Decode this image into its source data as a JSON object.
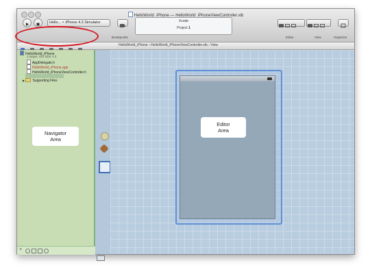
{
  "window": {
    "title": "HelloWorld_iPhone — HelloWorld_iPhoneViewController.xib"
  },
  "toolbar": {
    "scheme_label": "Hello... ‣ iPhone 4.3 Simulator",
    "breakpoints_label": "Breakpoints",
    "activity_title": "Xcode",
    "activity_project_label": "Project",
    "activity_count": "1",
    "editor_label": "Editor",
    "view_label": "View",
    "organizer_label": "Organizer"
  },
  "jumpbar": {
    "crumbs": [
      "HelloWorld_iPhone",
      "HelloWorld_iPhoneViewController.xib",
      "View"
    ]
  },
  "navigator": {
    "project_name": "HelloWorld_iPhone",
    "project_subtitle": "1 target, iOS SDK 4.3",
    "files": [
      {
        "name": "AppDelegate.h",
        "kind": "file",
        "color": "#222222"
      },
      {
        "name": "HelloWorld_iPhone.app",
        "kind": "file",
        "color": "#b23b2f"
      },
      {
        "name": "HelloWorld_iPhoneViewController.h",
        "kind": "file",
        "color": "#222222"
      },
      {
        "name": "Supporting Files",
        "kind": "folder",
        "color": "#222222"
      }
    ],
    "area_label": "Navigator\nArea"
  },
  "editor": {
    "area_label": "Editor\nArea"
  },
  "colors": {
    "navigator_bg": "#c8ddb4",
    "editor_bg": "#b9cde0",
    "annotation": "#d7141e",
    "selection_outline": "#5f8fd6"
  },
  "icons": [
    "run-icon",
    "stop-icon",
    "folder-icon",
    "file-icon",
    "battery-icon",
    "placeholder-icon",
    "first-responder-icon",
    "view-icon"
  ]
}
